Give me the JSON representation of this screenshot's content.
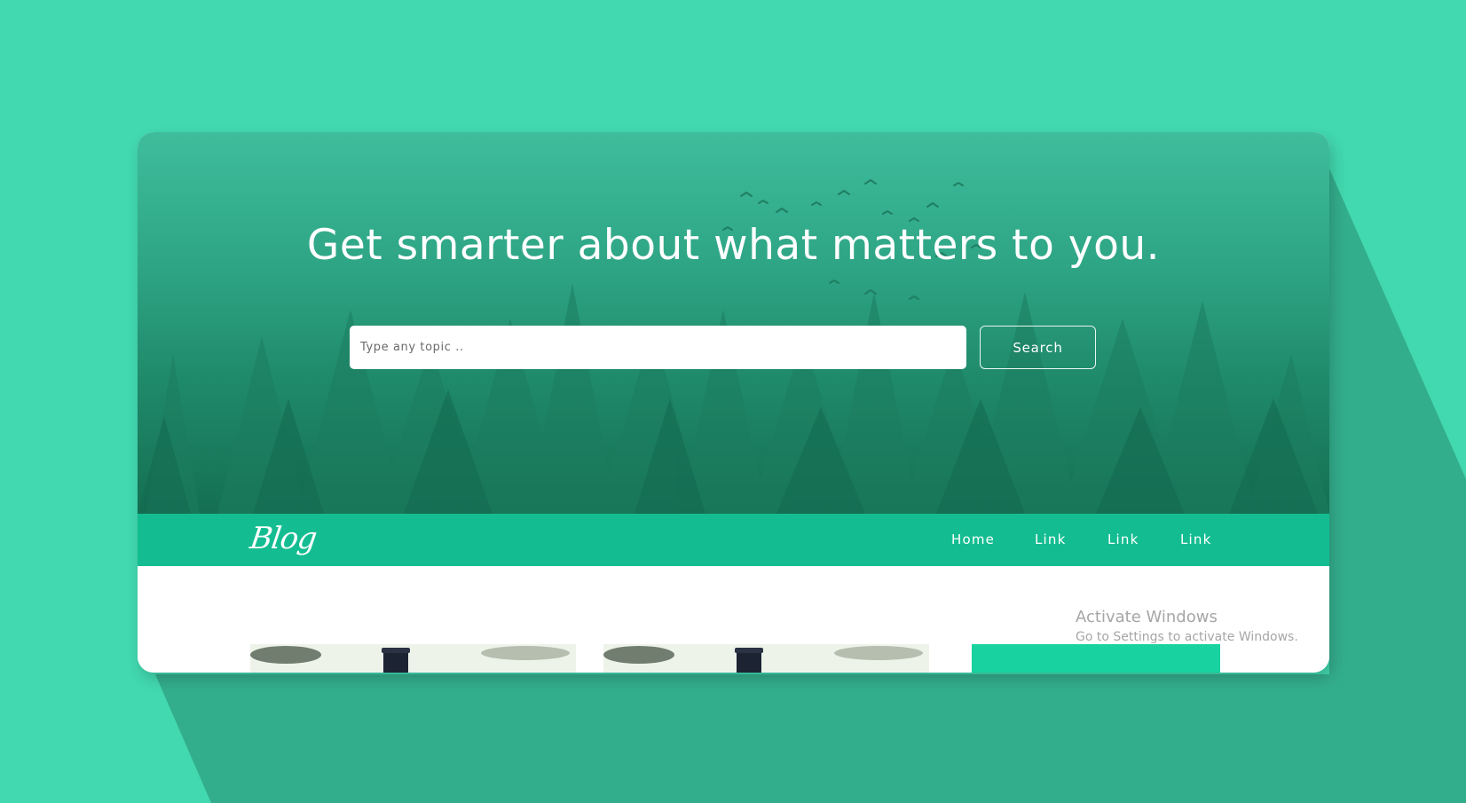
{
  "hero": {
    "headline": "Get smarter about what matters to you.",
    "search_placeholder": "Type any topic ..",
    "search_button_label": "Search"
  },
  "navbar": {
    "brand": "Blog",
    "links": [
      "Home",
      "Link",
      "Link",
      "Link"
    ]
  },
  "watermark": {
    "title": "Activate Windows",
    "subtitle": "Go to Settings to activate Windows."
  },
  "colors": {
    "page_background": "#42d8b0",
    "navbar": "#14bd91",
    "sidebar_accent": "#18d39f"
  }
}
